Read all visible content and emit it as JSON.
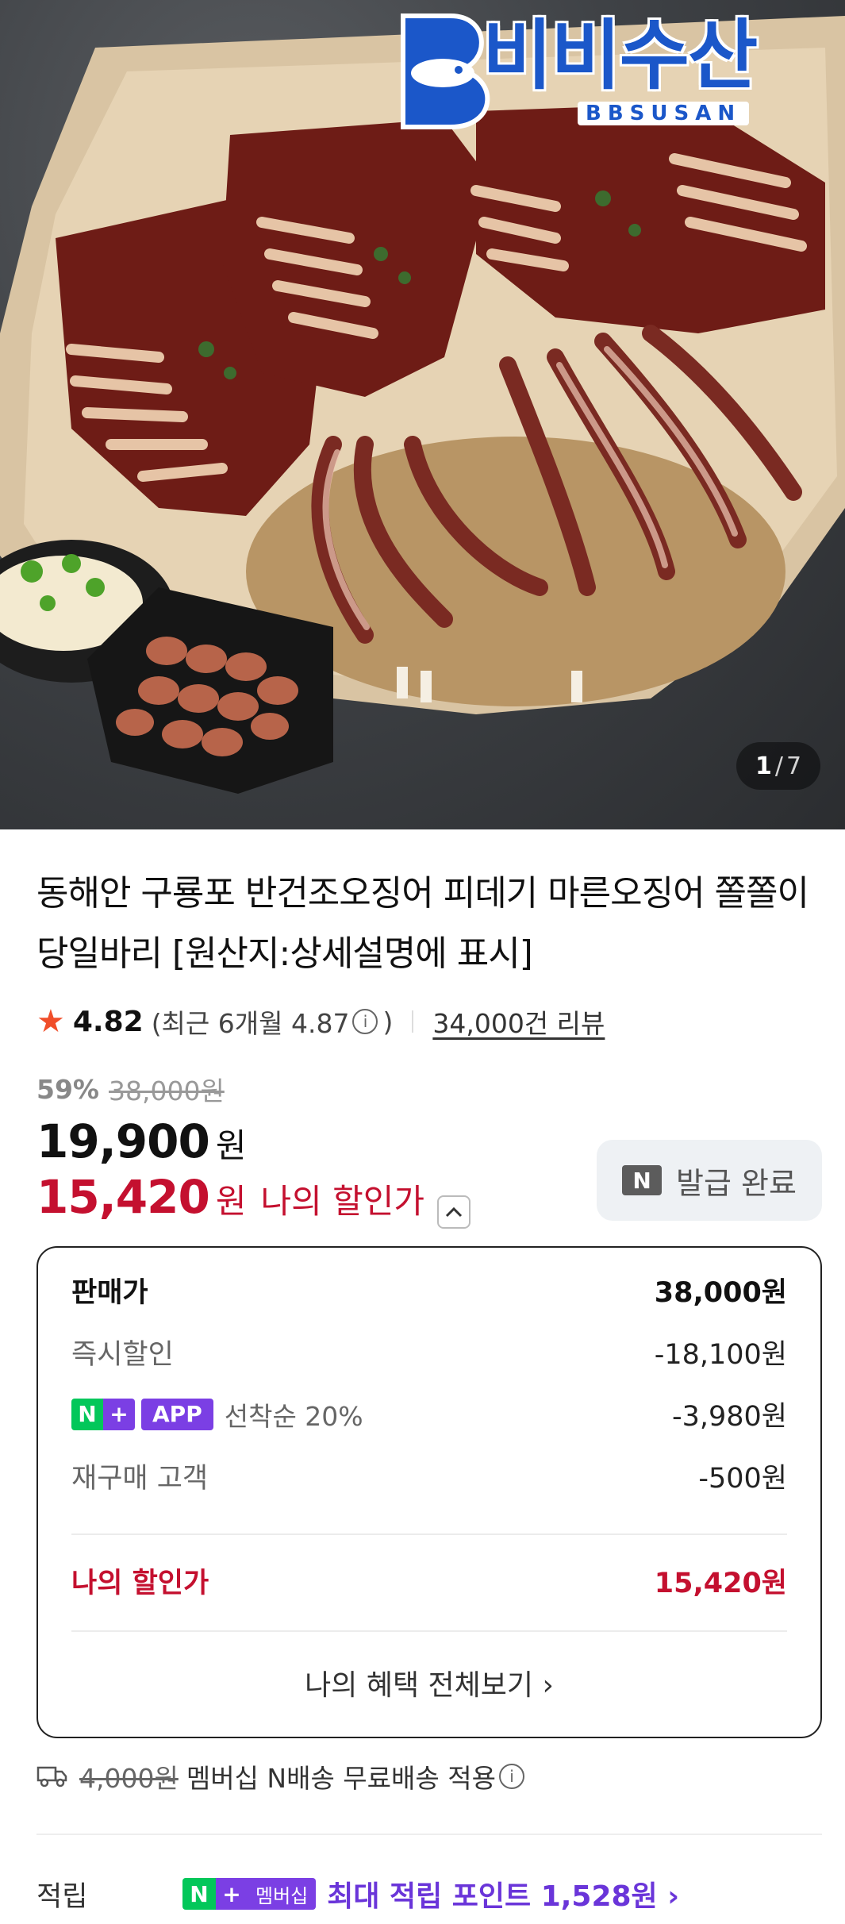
{
  "brand": {
    "logo_text": "비비수산",
    "logo_sub": "BBSUSAN",
    "accent": "#1b57c9"
  },
  "gallery": {
    "current": "1",
    "separator": "/",
    "total": "7"
  },
  "product": {
    "title": "동해안 구룡포 반건조오징어 피데기 마른오징어 쫄쫄이 당일바리 [원산지:상세설명에 표시]"
  },
  "rating": {
    "star_icon": "star-icon",
    "score": "4.82",
    "recent_text": "(최근 6개월 4.87",
    "info_icon": "i",
    "recent_close": ")",
    "reviews_link": "34,000건 리뷰"
  },
  "price": {
    "discount_rate": "59%",
    "original_price": "38,000원",
    "sale_price": "19,900",
    "sale_unit": "원",
    "my_price": "15,420",
    "my_unit": "원",
    "my_label": "나의 할인가",
    "toggle_icon": "chevron-up-icon"
  },
  "coupon": {
    "badge": "N",
    "label": "발급 완료"
  },
  "breakdown": {
    "rows": [
      {
        "label": "판매가",
        "value": "38,000원"
      },
      {
        "label": "즉시할인",
        "value": "-18,100원"
      },
      {
        "tag_n": "N",
        "tag_plus": "+",
        "tag_app": "APP",
        "label": "선착순 20%",
        "value": "-3,980원"
      },
      {
        "label": "재구매 고객",
        "value": "-500원"
      }
    ],
    "total": {
      "label": "나의 할인가",
      "value": "15,420원"
    },
    "view_all": "나의 혜택 전체보기 ›"
  },
  "shipping": {
    "old_fee": "4,000원",
    "text": "멤버십 N배송 무료배송 적용",
    "info_icon": "i"
  },
  "points": {
    "label": "적립",
    "badge_n": "N",
    "badge_plus": "+",
    "badge_text": "멤버십",
    "value": "최대 적립 포인트 1,528원 ›"
  },
  "colors": {
    "sale_red": "#c4102f",
    "naver_green": "#03c75a",
    "plus_purple": "#7b3fe4",
    "star_orange": "#f04e2a"
  }
}
